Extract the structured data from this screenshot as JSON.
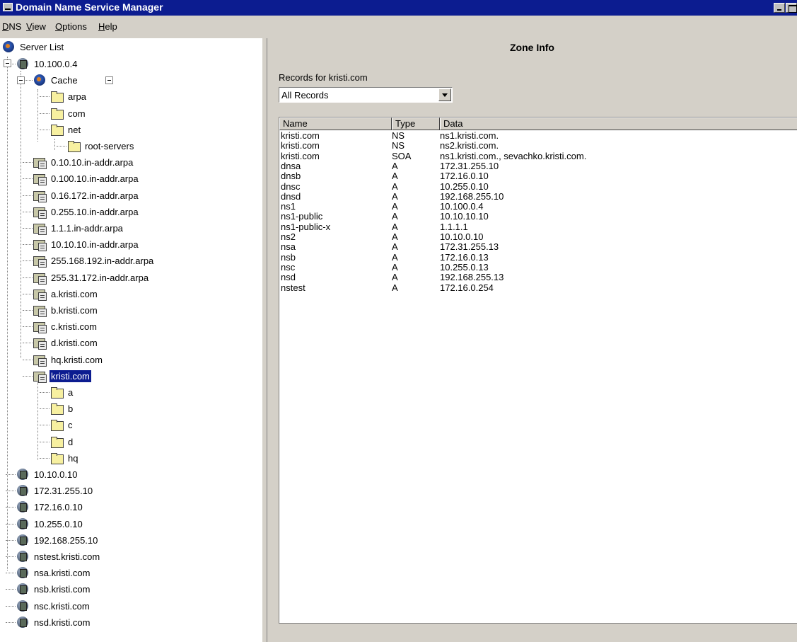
{
  "window": {
    "title": "Domain Name Service Manager"
  },
  "menu": [
    "DNS",
    "View",
    "Options",
    "Help"
  ],
  "tree": {
    "root_label": "Server List",
    "items": [
      {
        "label": "10.100.0.4",
        "kind": "server"
      },
      {
        "label": "Cache",
        "kind": "cache"
      },
      {
        "label": "arpa",
        "kind": "folder"
      },
      {
        "label": "com",
        "kind": "folder"
      },
      {
        "label": "net",
        "kind": "folder"
      },
      {
        "label": "root-servers",
        "kind": "folder"
      },
      {
        "label": "0.10.10.in-addr.arpa",
        "kind": "zone"
      },
      {
        "label": "0.100.10.in-addr.arpa",
        "kind": "zone"
      },
      {
        "label": "0.16.172.in-addr.arpa",
        "kind": "zone"
      },
      {
        "label": "0.255.10.in-addr.arpa",
        "kind": "zone"
      },
      {
        "label": "1.1.1.in-addr.arpa",
        "kind": "zone"
      },
      {
        "label": "10.10.10.in-addr.arpa",
        "kind": "zone"
      },
      {
        "label": "255.168.192.in-addr.arpa",
        "kind": "zone"
      },
      {
        "label": "255.31.172.in-addr.arpa",
        "kind": "zone"
      },
      {
        "label": "a.kristi.com",
        "kind": "zone"
      },
      {
        "label": "b.kristi.com",
        "kind": "zone"
      },
      {
        "label": "c.kristi.com",
        "kind": "zone"
      },
      {
        "label": "d.kristi.com",
        "kind": "zone"
      },
      {
        "label": "hq.kristi.com",
        "kind": "zone"
      },
      {
        "label": "kristi.com",
        "kind": "zone",
        "selected": true
      },
      {
        "label": "a",
        "kind": "folder"
      },
      {
        "label": "b",
        "kind": "folder"
      },
      {
        "label": "c",
        "kind": "folder"
      },
      {
        "label": "d",
        "kind": "folder"
      },
      {
        "label": "hq",
        "kind": "folder"
      },
      {
        "label": "10.10.0.10",
        "kind": "server"
      },
      {
        "label": "172.31.255.10",
        "kind": "server"
      },
      {
        "label": "172.16.0.10",
        "kind": "server"
      },
      {
        "label": "10.255.0.10",
        "kind": "server"
      },
      {
        "label": "192.168.255.10",
        "kind": "server"
      },
      {
        "label": "nstest.kristi.com",
        "kind": "server"
      },
      {
        "label": "nsa.kristi.com",
        "kind": "server"
      },
      {
        "label": "nsb.kristi.com",
        "kind": "server"
      },
      {
        "label": "nsc.kristi.com",
        "kind": "server"
      },
      {
        "label": "nsd.kristi.com",
        "kind": "server"
      }
    ]
  },
  "zone_info": {
    "title": "Zone Info",
    "records_for": "Records for kristi.com",
    "filter_value": "All Records",
    "columns": [
      "Name",
      "Type",
      "Data"
    ],
    "records": [
      [
        "kristi.com",
        "NS",
        "ns1.kristi.com."
      ],
      [
        "kristi.com",
        "NS",
        "ns2.kristi.com."
      ],
      [
        "kristi.com",
        "SOA",
        "ns1.kristi.com., sevachko.kristi.com."
      ],
      [
        "dnsa",
        "A",
        "172.31.255.10"
      ],
      [
        "dnsb",
        "A",
        "172.16.0.10"
      ],
      [
        "dnsc",
        "A",
        "10.255.0.10"
      ],
      [
        "dnsd",
        "A",
        "192.168.255.10"
      ],
      [
        "ns1",
        "A",
        "10.100.0.4"
      ],
      [
        "ns1-public",
        "A",
        "10.10.10.10"
      ],
      [
        "ns1-public-x",
        "A",
        "1.1.1.1"
      ],
      [
        "ns2",
        "A",
        "10.10.0.10"
      ],
      [
        "nsa",
        "A",
        "172.31.255.13"
      ],
      [
        "nsb",
        "A",
        "172.16.0.13"
      ],
      [
        "nsc",
        "A",
        "10.255.0.13"
      ],
      [
        "nsd",
        "A",
        "192.168.255.13"
      ],
      [
        "nstest",
        "A",
        "172.16.0.254"
      ]
    ]
  },
  "colors": {
    "titlebar": "#0c1c90",
    "face": "#d4d0c8",
    "selection": "#0c1c90"
  }
}
